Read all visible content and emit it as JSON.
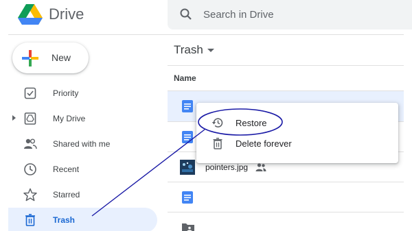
{
  "header": {
    "app_title": "Drive",
    "search_placeholder": "Search in Drive"
  },
  "sidebar": {
    "new_label": "New",
    "items": [
      {
        "label": "Priority",
        "icon": "priority-icon"
      },
      {
        "label": "My Drive",
        "icon": "my-drive-icon"
      },
      {
        "label": "Shared with me",
        "icon": "shared-with-me-icon"
      },
      {
        "label": "Recent",
        "icon": "clock-icon"
      },
      {
        "label": "Starred",
        "icon": "star-icon"
      },
      {
        "label": "Trash",
        "icon": "trash-icon",
        "active": true
      }
    ]
  },
  "main": {
    "folder_title": "Trash",
    "column_name": "Name",
    "rows": [
      {
        "name": "",
        "icon": "google-doc-icon",
        "selected": true
      },
      {
        "name": "",
        "icon": "google-doc-icon"
      },
      {
        "name": "pointers.jpg",
        "icon": "image-thumbnail",
        "shared": true
      },
      {
        "name": "",
        "icon": "google-doc-icon"
      },
      {
        "name": "",
        "icon": "shared-folder-icon"
      }
    ]
  },
  "context_menu": {
    "items": [
      {
        "label": "Restore",
        "icon": "restore-icon"
      },
      {
        "label": "Delete forever",
        "icon": "trash-icon"
      }
    ]
  },
  "colors": {
    "accent_blue": "#1a73e8",
    "active_bg": "#e8f0fe",
    "annotation": "#1a1aa6"
  }
}
